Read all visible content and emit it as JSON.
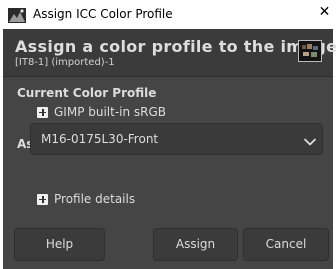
{
  "window": {
    "title": "Assign ICC Color Profile",
    "close_glyph": "✕"
  },
  "header": {
    "title": "Assign a color profile to the image",
    "subtitle": "[IT8-1] (imported)-1"
  },
  "current_profile": {
    "section_label": "Current Color Profile",
    "expander_label": "GIMP built-in sRGB"
  },
  "assign": {
    "section_label": "Assign",
    "selected_profile": "M16-0175L30-Front",
    "details_label": "Profile details"
  },
  "buttons": {
    "help": "Help",
    "assign": "Assign",
    "cancel": "Cancel"
  },
  "icons": {
    "app": "gimp-app-icon",
    "close": "close-icon",
    "thumbnail": "image-thumbnail",
    "expander": "plus-expander-icon",
    "dropdown": "chevron-down-icon"
  },
  "colors": {
    "dialog_background": "#454545",
    "header_background": "#3b3b3b",
    "text": "#dcdcdc"
  }
}
